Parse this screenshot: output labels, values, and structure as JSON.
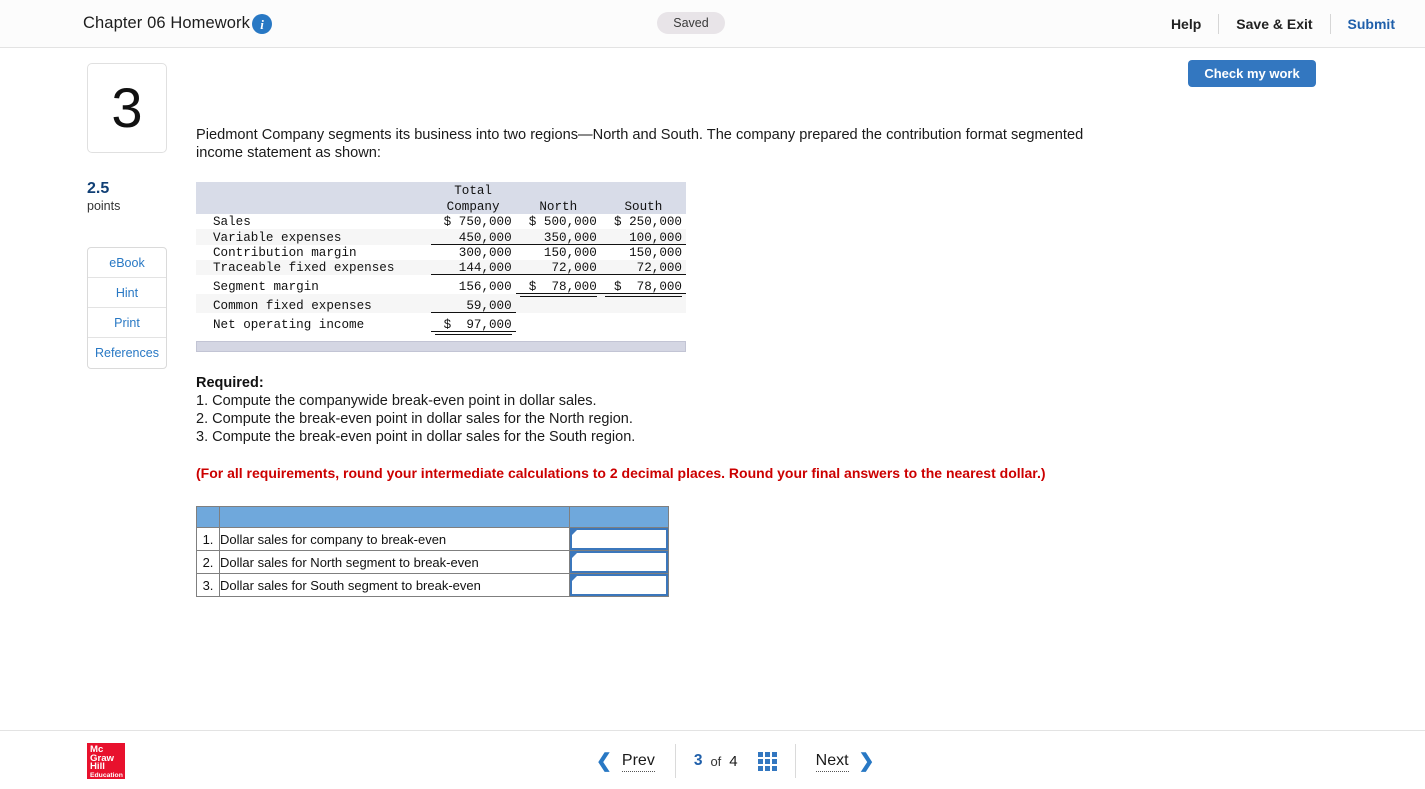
{
  "topbar": {
    "title": "Chapter 06 Homework",
    "info_icon": "info-icon",
    "saved_label": "Saved",
    "help_label": "Help",
    "save_exit_label": "Save & Exit",
    "submit_label": "Submit"
  },
  "sidebar": {
    "question_number": "3",
    "points_value": "2.5",
    "points_label": "points",
    "resources": [
      {
        "label": "eBook"
      },
      {
        "label": "Hint"
      },
      {
        "label": "Print"
      },
      {
        "label": "References"
      }
    ]
  },
  "main": {
    "check_my_work_label": "Check my work",
    "prompt": "Piedmont Company segments its business into two regions—North and South. The company prepared the contribution format segmented income statement as shown:",
    "required_title": "Required:",
    "requirements": [
      "1. Compute the companywide break-even point in dollar sales.",
      "2. Compute the break-even point in dollar sales for the North region.",
      "3. Compute the break-even point in dollar sales for the South region."
    ],
    "note": "(For all requirements, round your intermediate calculations to 2 decimal places.  Round your final answers to the nearest dollar.)"
  },
  "statement": {
    "headers": [
      "",
      "Total\nCompany",
      "North",
      "South"
    ],
    "header_line1": "Total",
    "header_total_company": "Company",
    "header_north": "North",
    "header_south": "South",
    "rows": [
      {
        "label": "Sales",
        "total": "$ 750,000",
        "north": "$ 500,000",
        "south": "$ 250,000"
      },
      {
        "label": "Variable expenses",
        "total": "450,000",
        "north": "350,000",
        "south": "100,000"
      },
      {
        "label": "Contribution margin",
        "total": "300,000",
        "north": "150,000",
        "south": "150,000"
      },
      {
        "label": "Traceable fixed expenses",
        "total": "144,000",
        "north": "72,000",
        "south": "72,000"
      },
      {
        "label": "Segment margin",
        "total": "156,000",
        "north": "$  78,000",
        "south": "$  78,000"
      },
      {
        "label": "Common fixed expenses",
        "total": "59,000",
        "north": "",
        "south": ""
      },
      {
        "label": "Net operating income",
        "total": "$  97,000",
        "north": "",
        "south": ""
      }
    ]
  },
  "answer_grid": {
    "rows": [
      {
        "index": "1.",
        "label": "Dollar sales for company to break-even",
        "value": ""
      },
      {
        "index": "2.",
        "label": "Dollar sales for North segment to break-even",
        "value": ""
      },
      {
        "index": "3.",
        "label": "Dollar sales for South segment to break-even",
        "value": ""
      }
    ]
  },
  "footer": {
    "logo_line1": "Mc",
    "logo_line2": "Graw",
    "logo_line3": "Hill",
    "logo_line4": "Education",
    "prev_label": "Prev",
    "next_label": "Next",
    "page_current": "3",
    "page_of": "of",
    "page_total": "4",
    "grid_icon": "grid-view-icon"
  },
  "colors": {
    "accent_blue": "#2878c4",
    "button_blue": "#3377c0",
    "grid_header_blue": "#6fa8dc",
    "note_red": "#cc0000",
    "logo_red": "#e8112d",
    "statement_header": "#d8dce8"
  }
}
